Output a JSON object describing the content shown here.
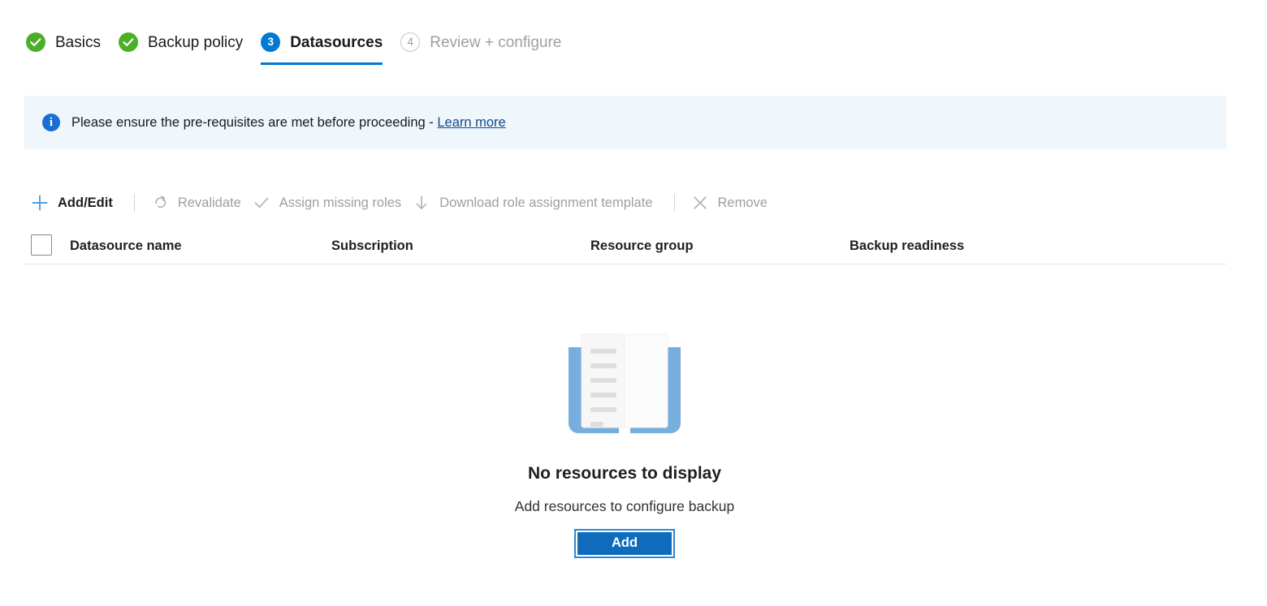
{
  "wizard": {
    "tabs": [
      {
        "label": "Basics",
        "state": "done",
        "icon": "check-circle-icon",
        "number": "1"
      },
      {
        "label": "Backup policy",
        "state": "done",
        "icon": "check-circle-icon",
        "number": "2"
      },
      {
        "label": "Datasources",
        "state": "current",
        "icon": "step-number-badge",
        "number": "3"
      },
      {
        "label": "Review + configure",
        "state": "pending",
        "icon": "step-number-badge",
        "number": "4"
      }
    ]
  },
  "banner": {
    "icon": "info-icon",
    "glyph": "i",
    "text": "Please ensure the pre-requisites are met before proceeding - ",
    "link_label": "Learn more",
    "background": "#eff6fc",
    "icon_color": "#1a6dd4",
    "link_color": "#0f4a8a"
  },
  "toolbar": {
    "commands": [
      {
        "label": "Add/Edit",
        "icon": "plus-icon",
        "enabled": true
      },
      {
        "label": "Revalidate",
        "icon": "refresh-icon",
        "enabled": false
      },
      {
        "label": "Assign missing roles",
        "icon": "checkmark-icon",
        "enabled": false
      },
      {
        "label": "Download role assignment template",
        "icon": "download-icon",
        "enabled": false
      },
      {
        "label": "Remove",
        "icon": "close-icon",
        "enabled": false
      }
    ]
  },
  "table": {
    "select_all_checked": false,
    "columns": [
      "Datasource name",
      "Subscription",
      "Resource group",
      "Backup readiness"
    ],
    "rows": []
  },
  "empty_state": {
    "illustration": "open-book-icon",
    "title": "No resources to display",
    "subtitle": "Add resources to configure backup",
    "button_label": "Add",
    "button_color": "#0f6cbd"
  },
  "colors": {
    "accent": "#0078d4",
    "success": "#4caf28",
    "disabled_text": "#a19f9d",
    "text": "#1b1a19"
  }
}
